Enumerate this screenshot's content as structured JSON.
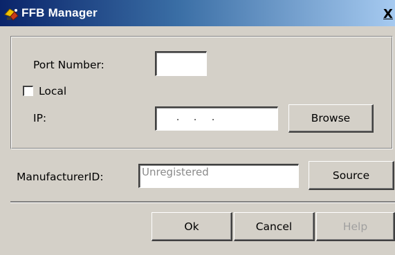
{
  "window": {
    "title": "FFB Manager",
    "close_label": "X"
  },
  "connection": {
    "port_label": "Port Number:",
    "port_value": "",
    "local_label": "Local",
    "local_checked": false,
    "ip_label": "IP:",
    "ip_separator": ".",
    "browse_label": "Browse"
  },
  "manufacturer": {
    "label": "ManufacturerID:",
    "value": "Unregistered",
    "source_label": "Source"
  },
  "footer": {
    "ok_label": "Ok",
    "cancel_label": "Cancel",
    "help_label": "Help",
    "help_enabled": false
  },
  "icons": {
    "app": "ffb-manager-icon",
    "close": "close-icon"
  },
  "colors": {
    "titlebar_start": "#0a246a",
    "titlebar_end": "#a6caf0",
    "dialog_bg": "#d4d0c8",
    "disabled_text": "#a0a0a0"
  }
}
